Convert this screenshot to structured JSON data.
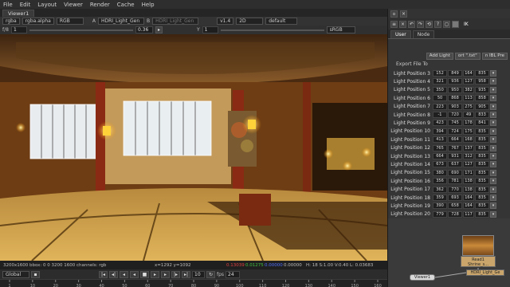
{
  "menu": [
    "File",
    "Edit",
    "Layout",
    "Viewer",
    "Render",
    "Cache",
    "Help"
  ],
  "viewer_tab": "Viewer1",
  "controls": {
    "channels": "rgba",
    "alpha": "rgba.alpha",
    "colorspace": "RGB",
    "a_input": "A",
    "a_node": "HDRI_Light_Gen",
    "b_input": "B",
    "b_node": "HDRI_Light_Gen",
    "zoom": "v1.4",
    "view_mode": "2D",
    "lut": "default",
    "gain_label": "f/8",
    "gain": "1",
    "gamma": "0.36",
    "y_label": "Y",
    "frame": "1",
    "proxy": "sRGB"
  },
  "info": {
    "format": "3200x1600 bbox: 0 0 3200 1600 channels: rgb",
    "coords": "x=1292 y=1092",
    "r": "0.13039",
    "g": "0.01275",
    "b": "0.00000",
    "a": "0.00000",
    "hsv": "H: 18 S:1.00 V:0.40  L: 0.03683"
  },
  "timeline": {
    "range": "Global",
    "fps_label": "fps",
    "fps": "24",
    "frame_field": "10",
    "ticks": [
      "1",
      "10",
      "20",
      "30",
      "40",
      "50",
      "60",
      "70",
      "80",
      "90",
      "100",
      "110",
      "120",
      "130",
      "140",
      "150",
      "160"
    ]
  },
  "panel": {
    "node_name": "IK",
    "tabs": [
      "User",
      "Node"
    ],
    "buttons": [
      "Add Light",
      "ort \".txt\"",
      "n IBL Pre"
    ],
    "export_label": "Export File To",
    "lights": [
      {
        "label": "Light Position 3",
        "v": [
          "152",
          "849",
          "164",
          "835"
        ]
      },
      {
        "label": "Light Position 4",
        "v": [
          "321",
          "936",
          "127",
          "958"
        ]
      },
      {
        "label": "Light Position 5",
        "v": [
          "350",
          "950",
          "382",
          "935"
        ]
      },
      {
        "label": "Light Position 6",
        "v": [
          "50",
          "868",
          "113",
          "858"
        ]
      },
      {
        "label": "Light Position 7",
        "v": [
          "223",
          "903",
          "275",
          "905"
        ]
      },
      {
        "label": "Light Position 8",
        "v": [
          "-1",
          "720",
          "49",
          "833"
        ]
      },
      {
        "label": "Light Position 9",
        "v": [
          "423",
          "745",
          "178",
          "841"
        ]
      },
      {
        "label": "Light Position 10",
        "v": [
          "394",
          "724",
          "175",
          "835"
        ]
      },
      {
        "label": "Light Position 11",
        "v": [
          "413",
          "664",
          "168",
          "835"
        ]
      },
      {
        "label": "Light Position 12",
        "v": [
          "765",
          "767",
          "137",
          "835"
        ]
      },
      {
        "label": "Light Position 13",
        "v": [
          "664",
          "931",
          "312",
          "835"
        ]
      },
      {
        "label": "Light Position 14",
        "v": [
          "673",
          "637",
          "127",
          "835"
        ]
      },
      {
        "label": "Light Position 15",
        "v": [
          "380",
          "690",
          "171",
          "835"
        ]
      },
      {
        "label": "Light Position 16",
        "v": [
          "356",
          "781",
          "138",
          "835"
        ]
      },
      {
        "label": "Light Position 17",
        "v": [
          "362",
          "770",
          "138",
          "835"
        ]
      },
      {
        "label": "Light Position 18",
        "v": [
          "359",
          "693",
          "164",
          "835"
        ]
      },
      {
        "label": "Light Position 19",
        "v": [
          "390",
          "658",
          "164",
          "835"
        ]
      },
      {
        "label": "Light Position 20",
        "v": [
          "779",
          "728",
          "117",
          "835"
        ]
      }
    ]
  },
  "nodes": {
    "read": "Read1",
    "read_file": "Shrine_s...",
    "gen": "HDRI_Light_Ge",
    "viewer": "Viewer1"
  },
  "colors": {
    "r_readout": "#e04040",
    "g_readout": "#40c040",
    "b_readout": "#5070ff",
    "node_tan": "#c9a56b"
  }
}
